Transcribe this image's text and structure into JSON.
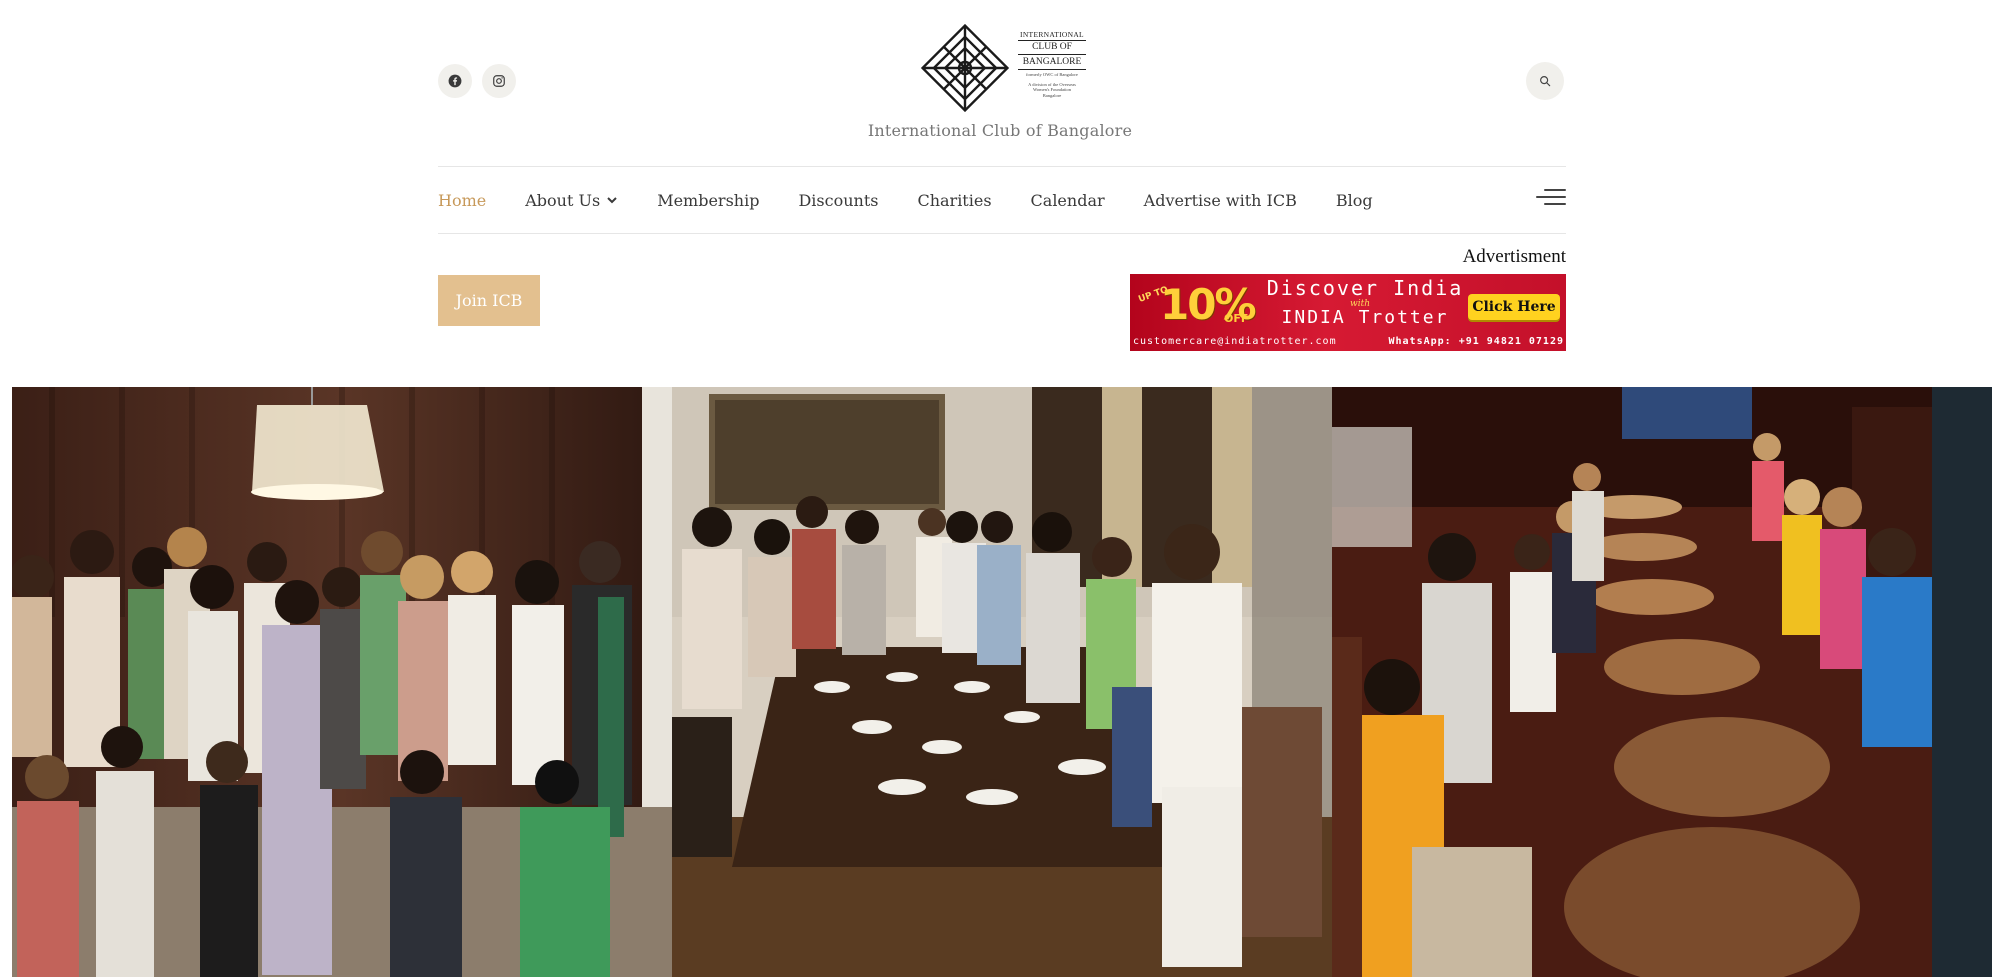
{
  "header": {
    "site_title": "International Club of Bangalore",
    "logo": {
      "line1": "INTERNATIONAL",
      "line2": "CLUB OF",
      "line3": "BANGALORE",
      "subtitle1": "formerly OWC of Bangalore",
      "subtitle2": "A division of the Overseas",
      "subtitle3": "Women's Foundation",
      "subtitle4": "Bangalore"
    },
    "social": [
      {
        "name": "facebook-icon"
      },
      {
        "name": "instagram-icon"
      }
    ],
    "search_icon": "search-icon"
  },
  "nav": {
    "items": [
      {
        "label": "Home",
        "active": true
      },
      {
        "label": "About Us",
        "has_dropdown": true
      },
      {
        "label": "Membership"
      },
      {
        "label": "Discounts"
      },
      {
        "label": "Charities"
      },
      {
        "label": "Calendar"
      },
      {
        "label": "Advertise with ICB"
      },
      {
        "label": "Blog"
      }
    ],
    "menu_icon": "hamburger-menu-icon"
  },
  "cta": {
    "join_label": "Join ICB"
  },
  "ad": {
    "label": "Advertisment",
    "upto": "UP TO",
    "percent": "10%",
    "off": "OFF",
    "headline": "Discover India",
    "with": "with",
    "brand": "INDIA Trotter",
    "button": "Click Here",
    "email": "customercare@indiatrotter.com",
    "whatsapp": "WhatsApp: +91 94821 07129"
  },
  "colors": {
    "accent": "#c7995a",
    "join_button": "#e3c08f",
    "ad_red": "#c4102a",
    "ad_button": "#ffd21f"
  }
}
